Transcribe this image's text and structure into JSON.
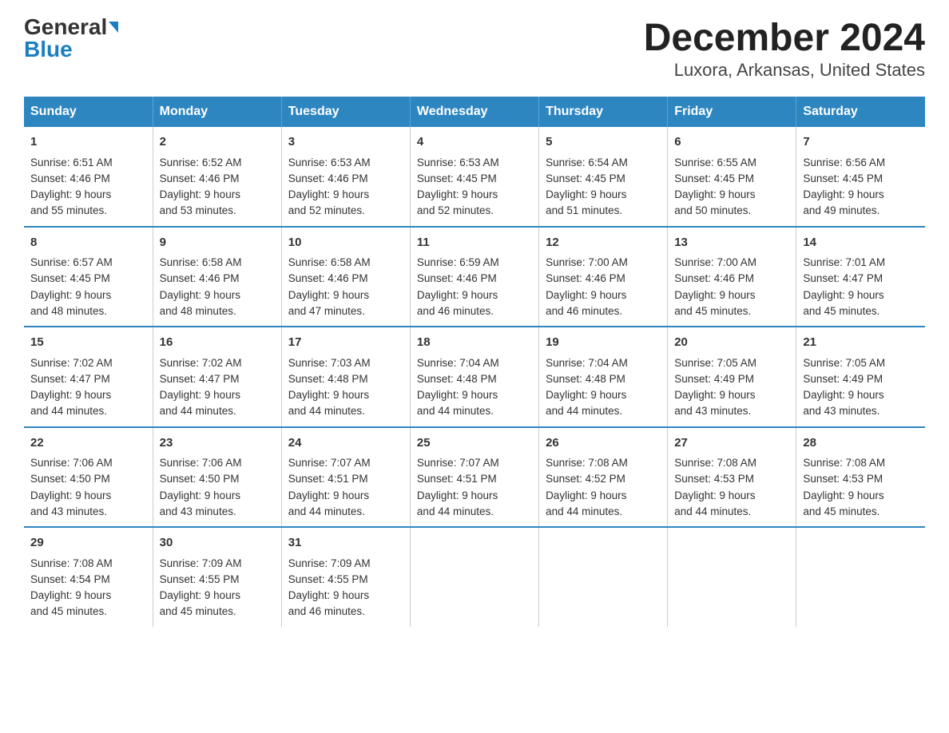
{
  "header": {
    "logo_general": "General",
    "logo_blue": "Blue",
    "title": "December 2024",
    "subtitle": "Luxora, Arkansas, United States"
  },
  "days_of_week": [
    "Sunday",
    "Monday",
    "Tuesday",
    "Wednesday",
    "Thursday",
    "Friday",
    "Saturday"
  ],
  "weeks": [
    [
      {
        "day": "1",
        "sunrise": "6:51 AM",
        "sunset": "4:46 PM",
        "daylight": "9 hours and 55 minutes."
      },
      {
        "day": "2",
        "sunrise": "6:52 AM",
        "sunset": "4:46 PM",
        "daylight": "9 hours and 53 minutes."
      },
      {
        "day": "3",
        "sunrise": "6:53 AM",
        "sunset": "4:46 PM",
        "daylight": "9 hours and 52 minutes."
      },
      {
        "day": "4",
        "sunrise": "6:53 AM",
        "sunset": "4:45 PM",
        "daylight": "9 hours and 52 minutes."
      },
      {
        "day": "5",
        "sunrise": "6:54 AM",
        "sunset": "4:45 PM",
        "daylight": "9 hours and 51 minutes."
      },
      {
        "day": "6",
        "sunrise": "6:55 AM",
        "sunset": "4:45 PM",
        "daylight": "9 hours and 50 minutes."
      },
      {
        "day": "7",
        "sunrise": "6:56 AM",
        "sunset": "4:45 PM",
        "daylight": "9 hours and 49 minutes."
      }
    ],
    [
      {
        "day": "8",
        "sunrise": "6:57 AM",
        "sunset": "4:45 PM",
        "daylight": "9 hours and 48 minutes."
      },
      {
        "day": "9",
        "sunrise": "6:58 AM",
        "sunset": "4:46 PM",
        "daylight": "9 hours and 48 minutes."
      },
      {
        "day": "10",
        "sunrise": "6:58 AM",
        "sunset": "4:46 PM",
        "daylight": "9 hours and 47 minutes."
      },
      {
        "day": "11",
        "sunrise": "6:59 AM",
        "sunset": "4:46 PM",
        "daylight": "9 hours and 46 minutes."
      },
      {
        "day": "12",
        "sunrise": "7:00 AM",
        "sunset": "4:46 PM",
        "daylight": "9 hours and 46 minutes."
      },
      {
        "day": "13",
        "sunrise": "7:00 AM",
        "sunset": "4:46 PM",
        "daylight": "9 hours and 45 minutes."
      },
      {
        "day": "14",
        "sunrise": "7:01 AM",
        "sunset": "4:47 PM",
        "daylight": "9 hours and 45 minutes."
      }
    ],
    [
      {
        "day": "15",
        "sunrise": "7:02 AM",
        "sunset": "4:47 PM",
        "daylight": "9 hours and 44 minutes."
      },
      {
        "day": "16",
        "sunrise": "7:02 AM",
        "sunset": "4:47 PM",
        "daylight": "9 hours and 44 minutes."
      },
      {
        "day": "17",
        "sunrise": "7:03 AM",
        "sunset": "4:48 PM",
        "daylight": "9 hours and 44 minutes."
      },
      {
        "day": "18",
        "sunrise": "7:04 AM",
        "sunset": "4:48 PM",
        "daylight": "9 hours and 44 minutes."
      },
      {
        "day": "19",
        "sunrise": "7:04 AM",
        "sunset": "4:48 PM",
        "daylight": "9 hours and 44 minutes."
      },
      {
        "day": "20",
        "sunrise": "7:05 AM",
        "sunset": "4:49 PM",
        "daylight": "9 hours and 43 minutes."
      },
      {
        "day": "21",
        "sunrise": "7:05 AM",
        "sunset": "4:49 PM",
        "daylight": "9 hours and 43 minutes."
      }
    ],
    [
      {
        "day": "22",
        "sunrise": "7:06 AM",
        "sunset": "4:50 PM",
        "daylight": "9 hours and 43 minutes."
      },
      {
        "day": "23",
        "sunrise": "7:06 AM",
        "sunset": "4:50 PM",
        "daylight": "9 hours and 43 minutes."
      },
      {
        "day": "24",
        "sunrise": "7:07 AM",
        "sunset": "4:51 PM",
        "daylight": "9 hours and 44 minutes."
      },
      {
        "day": "25",
        "sunrise": "7:07 AM",
        "sunset": "4:51 PM",
        "daylight": "9 hours and 44 minutes."
      },
      {
        "day": "26",
        "sunrise": "7:08 AM",
        "sunset": "4:52 PM",
        "daylight": "9 hours and 44 minutes."
      },
      {
        "day": "27",
        "sunrise": "7:08 AM",
        "sunset": "4:53 PM",
        "daylight": "9 hours and 44 minutes."
      },
      {
        "day": "28",
        "sunrise": "7:08 AM",
        "sunset": "4:53 PM",
        "daylight": "9 hours and 45 minutes."
      }
    ],
    [
      {
        "day": "29",
        "sunrise": "7:08 AM",
        "sunset": "4:54 PM",
        "daylight": "9 hours and 45 minutes."
      },
      {
        "day": "30",
        "sunrise": "7:09 AM",
        "sunset": "4:55 PM",
        "daylight": "9 hours and 45 minutes."
      },
      {
        "day": "31",
        "sunrise": "7:09 AM",
        "sunset": "4:55 PM",
        "daylight": "9 hours and 46 minutes."
      },
      null,
      null,
      null,
      null
    ]
  ],
  "labels": {
    "sunrise": "Sunrise:",
    "sunset": "Sunset:",
    "daylight": "Daylight:"
  }
}
